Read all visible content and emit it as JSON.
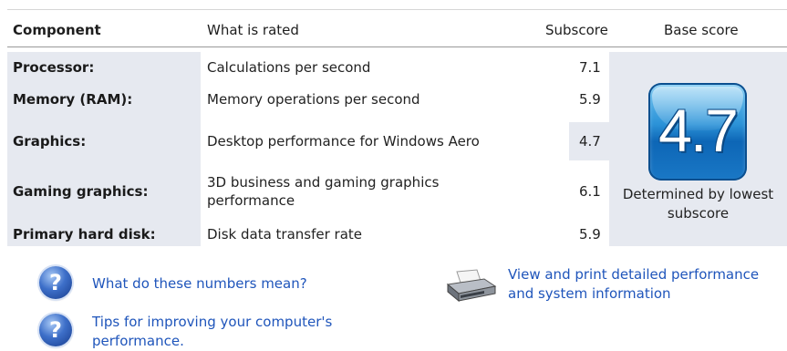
{
  "header": {
    "component": "Component",
    "what_is_rated": "What is rated",
    "subscore": "Subscore",
    "base_score": "Base score"
  },
  "rows": [
    {
      "component": "Processor:",
      "what": "Calculations per second",
      "subscore": "7.1"
    },
    {
      "component": "Memory (RAM):",
      "what": "Memory operations per second",
      "subscore": "5.9"
    },
    {
      "component": "Graphics:",
      "what": "Desktop performance for Windows Aero",
      "subscore": "4.7"
    },
    {
      "component": "Gaming graphics:",
      "what": "3D business and gaming graphics performance",
      "subscore": "6.1"
    },
    {
      "component": "Primary hard disk:",
      "what": "Disk data transfer rate",
      "subscore": "5.9"
    }
  ],
  "base_score": {
    "value": "4.7",
    "caption": "Determined by lowest subscore"
  },
  "links": {
    "numbers_meaning": "What do these numbers mean?",
    "tips": "Tips for improving your computer's performance.",
    "print_info": "View and print detailed performance and system information"
  },
  "icons": {
    "help": "question-mark-icon",
    "printer": "printer-icon"
  },
  "colors": {
    "link": "#1f55bb",
    "label_background": "#e6e9f0",
    "badge_blue": "#1a78c6"
  }
}
